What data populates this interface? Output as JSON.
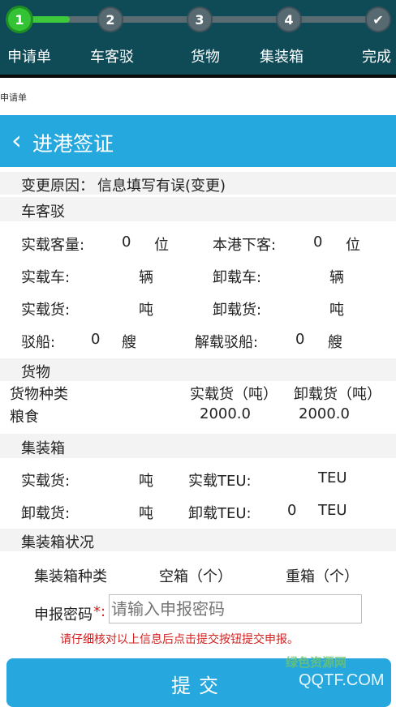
{
  "steps": [
    {
      "num": "1",
      "label": "申请单"
    },
    {
      "num": "2",
      "label": "车客驳"
    },
    {
      "num": "3",
      "label": "货物"
    },
    {
      "num": "4",
      "label": "集装箱"
    },
    {
      "num": "✔",
      "label": "完成"
    }
  ],
  "progress": 0.14,
  "breadcrumb": "申请单",
  "header": {
    "back_icon": "‹",
    "title": "进港签证"
  },
  "change_reason": {
    "label": "变更原因：",
    "value": "信息填写有误(变更)"
  },
  "car_passenger_barge": {
    "section": "车客驳",
    "loaded_passengers_label": "实载客量:",
    "loaded_passengers_value": "0",
    "passenger_unit": "位",
    "disembark_label": "本港下客:",
    "disembark_value": "0",
    "loaded_vehicles_label": "实载车:",
    "vehicle_unit": "辆",
    "unloaded_vehicles_label": "卸载车:",
    "loaded_cargo_label": "实载货:",
    "cargo_unit": "吨",
    "unloaded_cargo_label": "卸载货:",
    "barges_label": "驳船:",
    "barges_value": "0",
    "barge_unit": "艘",
    "unloaded_barges_label": "解载驳船:",
    "unloaded_barges_value": "0"
  },
  "cargo": {
    "section": "货物",
    "columns": [
      "货物种类",
      "实载货（吨）",
      "卸载货（吨）"
    ],
    "rows": [
      {
        "type": "粮食",
        "loaded": "2000.0",
        "unloaded": "2000.0"
      }
    ]
  },
  "container": {
    "section": "集装箱",
    "loaded_cargo_label": "实载货:",
    "ton_unit": "吨",
    "loaded_teu_label": "实载TEU:",
    "teu_unit": "TEU",
    "unloaded_cargo_label": "卸载货:",
    "unloaded_teu_label": "卸载TEU:",
    "unloaded_teu_value": "0"
  },
  "container_status": {
    "section": "集装箱状况",
    "columns": [
      "集装箱种类",
      "空箱（个）",
      "重箱（个）"
    ]
  },
  "password": {
    "label": "申报密码",
    "required_mark": "*:",
    "placeholder": "请输入申报密码"
  },
  "notice": "请仔细核对以上信息后点击提交按钮提交申报。",
  "submit_label": "提交",
  "watermark": {
    "line1": "绿色资源网",
    "line2": "QQTF.COM"
  }
}
